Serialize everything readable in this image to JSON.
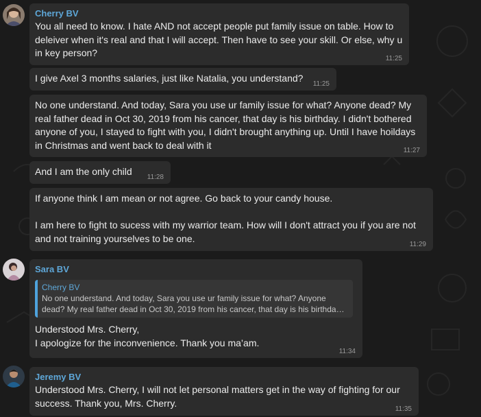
{
  "messages": [
    {
      "sender": "Cherry BV",
      "text": "You all need to know. I hate AND not accept people put family issue on table. How to deleiver when it's real and that I will accept. Then have to see your skill. Or else, why u in key person?",
      "time": "11:25"
    },
    {
      "text": "I give Axel 3 months salaries, just like Natalia, you understand?",
      "time": "11:25"
    },
    {
      "text": "No one understand. And today, Sara you use ur family issue for what? Anyone dead? My real father dead in Oct 30, 2019 from his cancer, that day is his birthday. I didn't bothered anyone of you, I stayed to fight with you, I didn't brought anything up. Until I have hoildays in Christmas and went back to deal with it",
      "time": "11:27"
    },
    {
      "text": "And I am the only child",
      "time": "11:28"
    },
    {
      "text": "If anyone think I am mean or not agree. Go back to your candy house.\n\nI am here to fight to sucess with my warrior team. How will I don't attract you if you are not and not training yourselves to be one.",
      "time": "11:29"
    },
    {
      "sender": "Sara BV",
      "reply": {
        "sender": "Cherry BV",
        "text": "No one understand. And today, Sara you use ur family issue for what? Anyone dead? My real father dead in Oct 30, 2019 from his cancer, that day is his birthday. I didn'..."
      },
      "text": "Understood Mrs. Cherry,\nI apologize for the inconvenience. Thank you ma’am.",
      "time": "11:34"
    },
    {
      "sender": "Jeremy BV",
      "text": "Understood Mrs. Cherry, I will not let personal matters get in the way of fighting for our success. Thank you, Mrs. Cherry.",
      "time": "11:35"
    }
  ],
  "colors": {
    "background": "#1b1b1b",
    "bubble": "#2c2c2c",
    "sender_name": "#5ea7d8",
    "reply_bar": "#4ea3dd"
  }
}
